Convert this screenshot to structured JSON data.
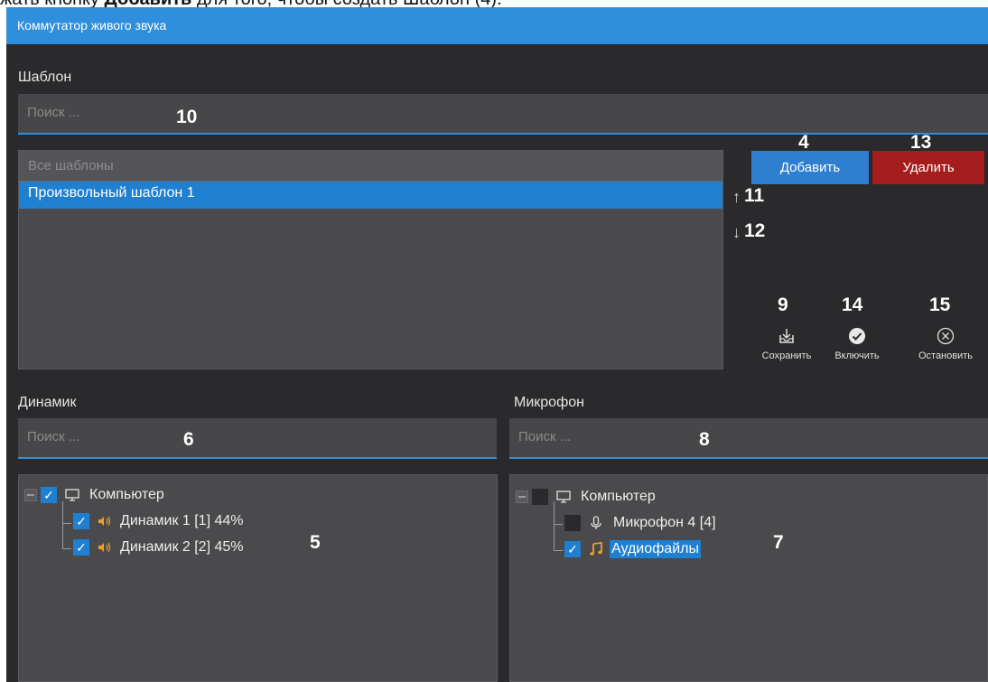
{
  "caption": {
    "before": "жать кнопку ",
    "bold": "Добавить",
    "after": " для того, чтобы создать Шаблон (4)."
  },
  "window": {
    "title": "Коммутатор живого звука"
  },
  "template_section": {
    "label": "Шаблон",
    "search_placeholder": "Поиск ...",
    "search_marker": "10",
    "list_header": "Все шаблоны",
    "items": [
      "Произвольный шаблон 1"
    ],
    "add_label": "Добавить",
    "add_marker": "4",
    "delete_label": "Удалить",
    "delete_marker": "13",
    "up_arrow": "↑",
    "up_marker": "11",
    "down_arrow": "↓",
    "down_marker": "12",
    "actions": {
      "save": {
        "label": "Сохранить",
        "marker": "9",
        "icon": "save-icon"
      },
      "enable": {
        "label": "Включить",
        "marker": "14",
        "icon": "check-circle-icon"
      },
      "stop": {
        "label": "Остановить",
        "marker": "15",
        "icon": "close-circle-icon"
      }
    }
  },
  "speaker_section": {
    "label": "Динамик",
    "search_placeholder": "Поиск ...",
    "search_marker": "6",
    "tree_marker": "5",
    "root": {
      "label": "Компьютер",
      "checked": true,
      "icon": "monitor-icon"
    },
    "children": [
      {
        "label": "Динамик 1 [1] 44%",
        "checked": true,
        "icon": "speaker-icon"
      },
      {
        "label": "Динамик 2 [2] 45%",
        "checked": true,
        "icon": "speaker-icon"
      }
    ]
  },
  "mic_section": {
    "label": "Микрофон",
    "search_placeholder": "Поиск ...",
    "search_marker": "8",
    "tree_marker": "7",
    "root": {
      "label": "Компьютер",
      "checked": false,
      "icon": "monitor-icon"
    },
    "children": [
      {
        "label": "Микрофон 4 [4]",
        "checked": false,
        "icon": "microphone-icon"
      },
      {
        "label": "Аудиофайлы",
        "checked": true,
        "icon": "music-note-icon",
        "selected": true
      }
    ]
  },
  "colors": {
    "accent": "#2f8fdc",
    "danger": "#a51d1d",
    "background": "#2a2a2c",
    "speaker_icon": "#f0a020"
  }
}
